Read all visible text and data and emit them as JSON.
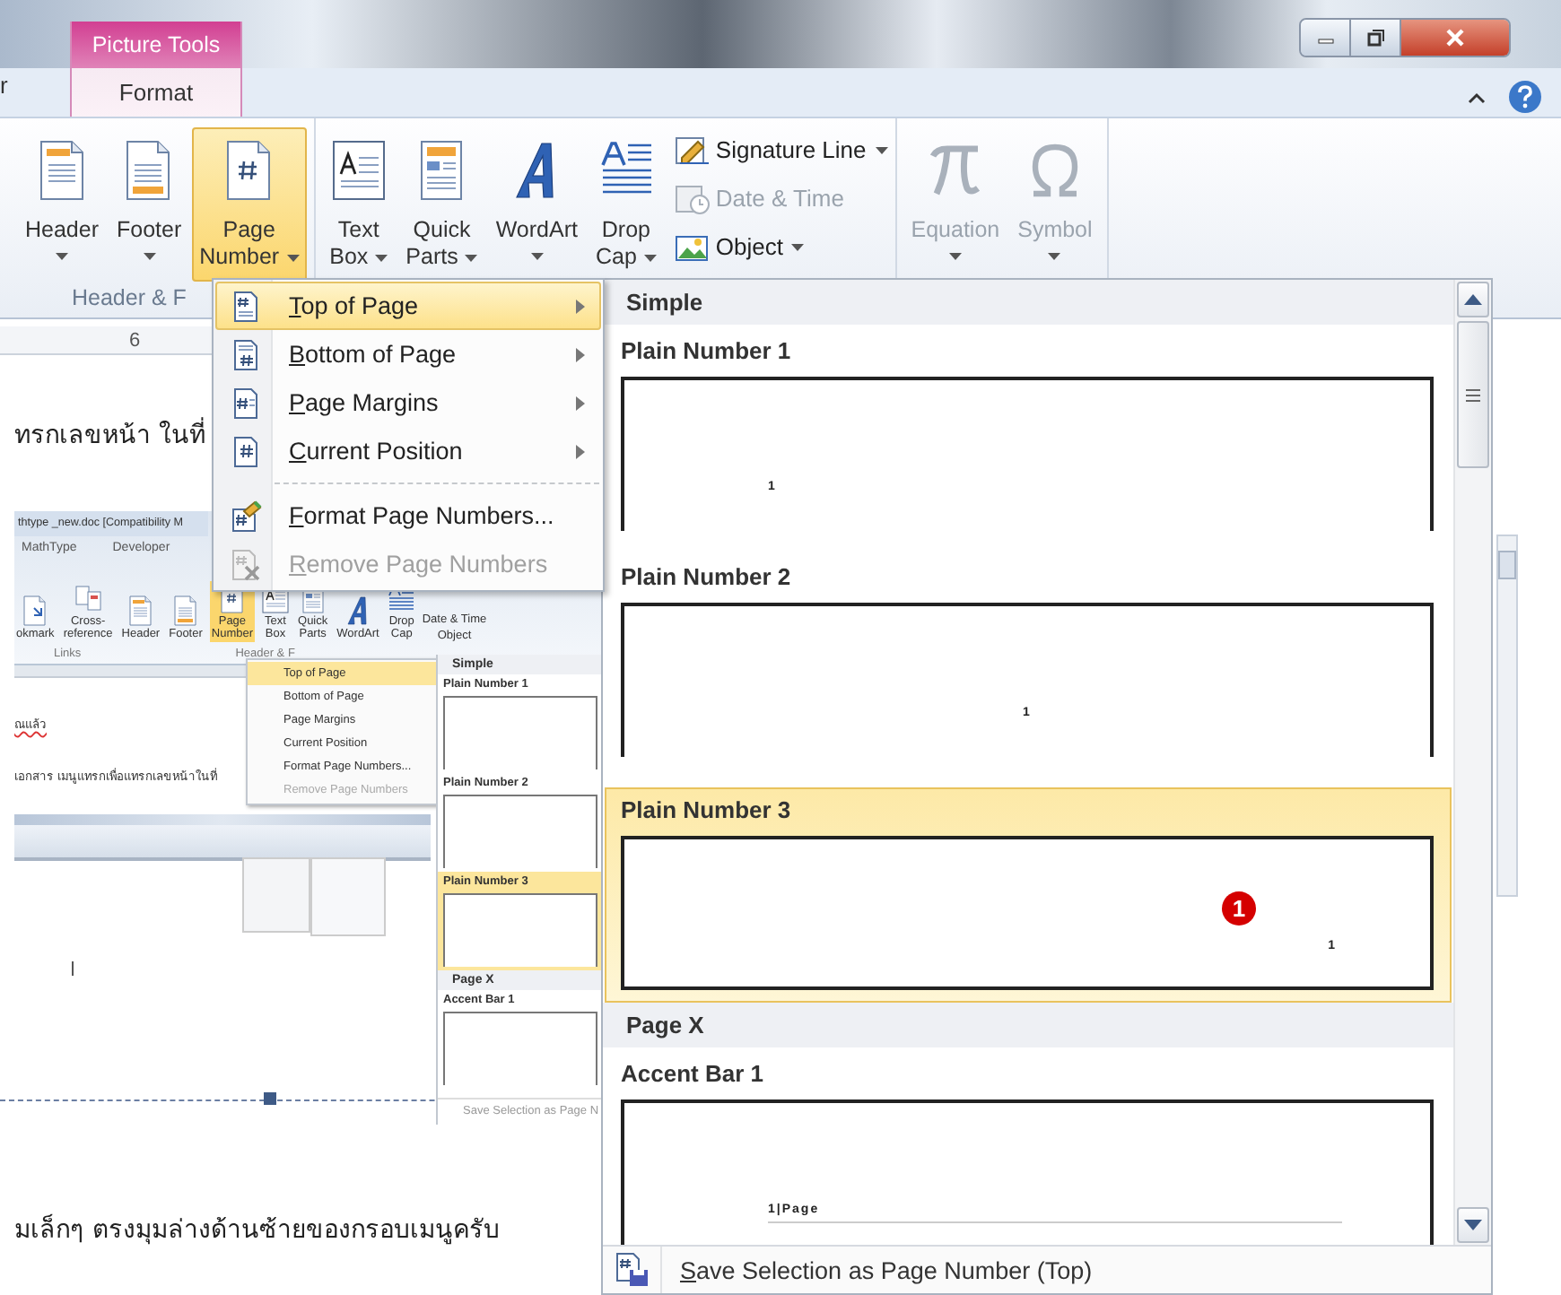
{
  "title_bar": {
    "partial_tab": "r",
    "contextual_group": "Picture Tools",
    "contextual_tab": "Format"
  },
  "ribbon": {
    "groups": [
      {
        "label": "Header & F",
        "items": [
          {
            "kind": "header",
            "label": [
              "Header"
            ],
            "dropdown": true,
            "selected": false,
            "disabled": false
          },
          {
            "kind": "footer",
            "label": [
              "Footer"
            ],
            "dropdown": true,
            "selected": false,
            "disabled": false
          },
          {
            "kind": "pagenumber",
            "label": [
              "Page",
              "Number"
            ],
            "dropdown": true,
            "selected": true,
            "disabled": false
          }
        ]
      },
      {
        "items": [
          {
            "kind": "textbox",
            "label": [
              "Text",
              "Box"
            ],
            "dropdown": true,
            "selected": false,
            "disabled": false
          },
          {
            "kind": "quickparts",
            "label": [
              "Quick",
              "Parts"
            ],
            "dropdown": true,
            "selected": false,
            "disabled": false
          },
          {
            "kind": "wordart",
            "label": [
              "WordArt"
            ],
            "dropdown": true,
            "selected": false,
            "disabled": false
          },
          {
            "kind": "dropcap",
            "label": [
              "Drop",
              "Cap"
            ],
            "dropdown": true,
            "selected": false,
            "disabled": false
          },
          {
            "kind": "stack",
            "buttons": [
              {
                "kind": "signature",
                "label": "Signature Line",
                "dropdown": true,
                "disabled": false
              },
              {
                "kind": "datetime",
                "label": "Date & Time",
                "dropdown": false,
                "disabled": true
              },
              {
                "kind": "object",
                "label": "Object",
                "dropdown": true,
                "disabled": false
              }
            ]
          }
        ]
      },
      {
        "items": [
          {
            "kind": "equation",
            "label": [
              "Equation"
            ],
            "dropdown": true,
            "selected": false,
            "disabled": true
          },
          {
            "kind": "symbol",
            "label": [
              "Symbol"
            ],
            "dropdown": true,
            "selected": false,
            "disabled": true
          }
        ]
      }
    ]
  },
  "menu": [
    {
      "kind": "top",
      "label": "Top of Page",
      "submenu": true,
      "selected": true,
      "disabled": false
    },
    {
      "kind": "bottom",
      "label": "Bottom of Page",
      "submenu": true,
      "selected": false,
      "disabled": false
    },
    {
      "kind": "margins",
      "label": "Page Margins",
      "submenu": true,
      "selected": false,
      "disabled": false
    },
    {
      "kind": "current",
      "label": "Current Position",
      "submenu": true,
      "selected": false,
      "disabled": false
    },
    {
      "kind": "format",
      "label": "Format Page Numbers...",
      "submenu": false,
      "selected": false,
      "disabled": false
    },
    {
      "kind": "remove",
      "label": "Remove Page Numbers",
      "submenu": false,
      "selected": false,
      "disabled": true
    }
  ],
  "gallery": {
    "sections": [
      {
        "heading": "Simple",
        "items": [
          {
            "kind": "left",
            "name": "Plain Number 1",
            "preview": "1",
            "selected": false
          },
          {
            "kind": "center",
            "name": "Plain Number 2",
            "preview": "1",
            "selected": false
          },
          {
            "kind": "right",
            "name": "Plain Number 3",
            "preview": "1",
            "selected": true,
            "marker": "1"
          }
        ]
      },
      {
        "heading": "Page X",
        "items": [
          {
            "kind": "accent",
            "name": "Accent Bar 1",
            "preview": "1|Page",
            "selected": false
          }
        ]
      }
    ],
    "footer": {
      "label": "Save Selection as Page Number (Top)"
    }
  },
  "document": {
    "ruler_number": "6",
    "heading": "ทรกเลขหน้า ในที่",
    "embedded_screenshot": {
      "title": "thtype _new.doc [Compatibility M",
      "tabs": [
        "MathType",
        "Developer"
      ],
      "buttons": [
        {
          "kind": "bookmark",
          "label": "okmark",
          "selected": false
        },
        {
          "kind": "crossref",
          "label": "Cross-reference",
          "selected": false
        },
        {
          "kind": "header",
          "label": "Header",
          "selected": false
        },
        {
          "kind": "footer",
          "label": "Footer",
          "selected": false
        },
        {
          "kind": "pagenumber",
          "label": "Page Number",
          "selected": true
        },
        {
          "kind": "textbox",
          "label": "Text Box",
          "selected": false
        },
        {
          "kind": "quickparts",
          "label": "Quick Parts",
          "selected": false
        },
        {
          "kind": "wordart",
          "label": "WordArt",
          "selected": false
        },
        {
          "kind": "dropcap",
          "label": "Drop Cap",
          "selected": false
        }
      ],
      "small_buttons": [
        "Date & Time",
        "Object"
      ],
      "group_labels": [
        "Links",
        "Header & F"
      ],
      "text_lines": [
        {
          "kind": "misspelled",
          "text": "ณแล้ว"
        },
        {
          "kind": "plain",
          "text": "เอกสาร เมนูแทรกเพื่อแทรกเลขหน้าในที่"
        }
      ],
      "menu": [
        {
          "label": "Top of Page",
          "selected": true,
          "disabled": false
        },
        {
          "label": "Bottom of Page",
          "selected": false,
          "disabled": false
        },
        {
          "label": "Page Margins",
          "selected": false,
          "disabled": false
        },
        {
          "label": "Current Position",
          "selected": false,
          "disabled": false
        },
        {
          "label": "Format Page Numbers...",
          "selected": false,
          "disabled": false
        },
        {
          "label": "Remove Page Numbers",
          "selected": false,
          "disabled": true
        }
      ],
      "gallery": {
        "sections": [
          {
            "heading": "Simple",
            "items": [
              {
                "name": "Plain Number 1",
                "selected": false
              },
              {
                "name": "Plain Number 2",
                "selected": false
              },
              {
                "name": "Plain Number 3",
                "selected": true
              }
            ]
          },
          {
            "heading": "Page X",
            "items": [
              {
                "name": "Accent Bar 1",
                "selected": false
              }
            ]
          }
        ],
        "footer": "Save Selection as Page N"
      }
    },
    "closing_text": "มเล็กๆ ตรงมุมล่างด้านซ้ายของกรอบเมนูครับ"
  }
}
